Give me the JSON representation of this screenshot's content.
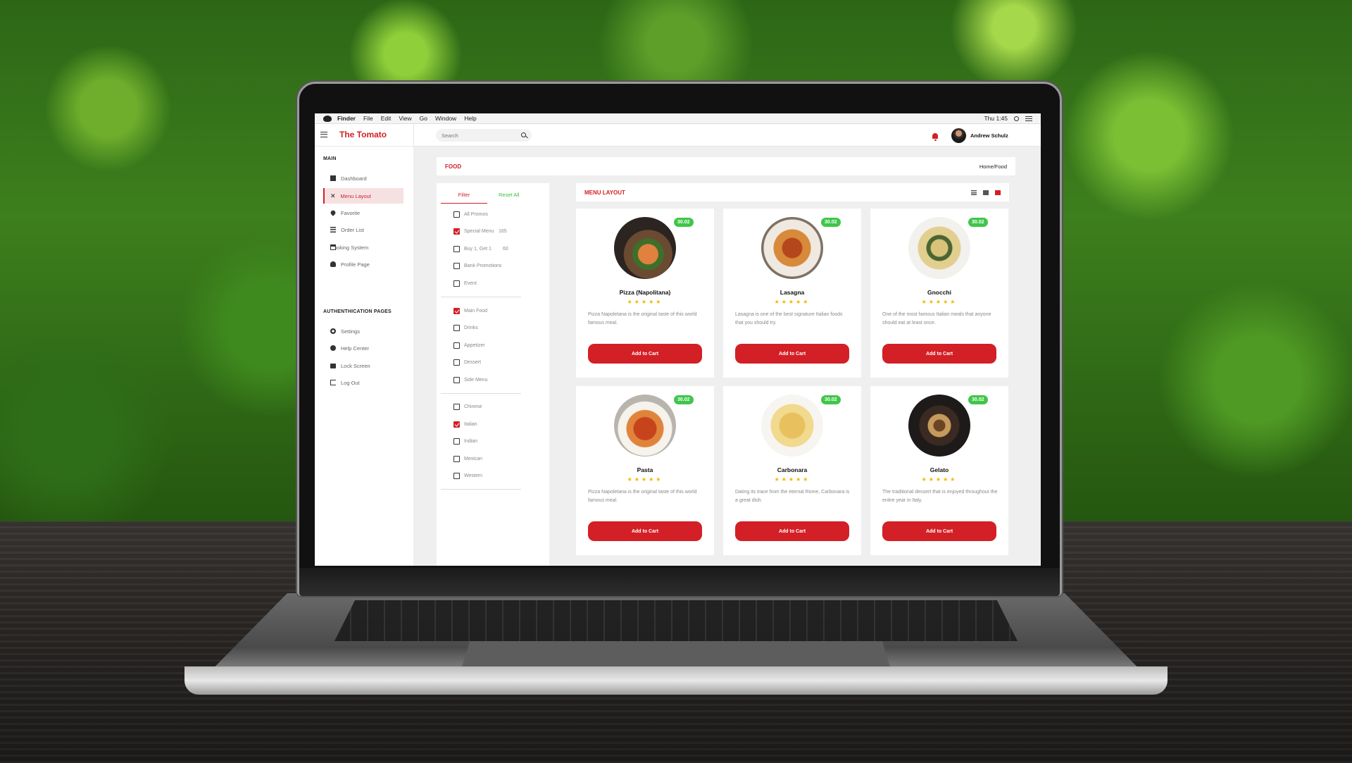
{
  "menubar": {
    "app": "Finder",
    "items": [
      "File",
      "Edit",
      "View",
      "Go",
      "Window",
      "Help"
    ],
    "clock": "Thu 1:45"
  },
  "topbar": {
    "brand": "The Tomato",
    "search_placeholder": "Search",
    "user_name": "Andrew Schulz"
  },
  "sidebar": {
    "main_heading": "MAIN",
    "items": [
      {
        "label": "Dashboard",
        "icon": "dashboard-icon"
      },
      {
        "label": "Menu Layout",
        "icon": "utensils-icon",
        "active": true
      },
      {
        "label": "Favorite",
        "icon": "heart-icon"
      },
      {
        "label": "Order List",
        "icon": "list-icon"
      },
      {
        "label": "Booking System",
        "icon": "credit-card-icon"
      },
      {
        "label": "Profile Page",
        "icon": "person-icon"
      }
    ],
    "auth_heading": "AUTHENTHICATION PAGES",
    "auth_items": [
      {
        "label": "Settings",
        "icon": "gear-icon"
      },
      {
        "label": "Help Center",
        "icon": "help-icon"
      },
      {
        "label": "Lock Screen",
        "icon": "lock-icon"
      },
      {
        "label": "Log Out",
        "icon": "logout-icon"
      }
    ]
  },
  "page": {
    "title": "FOOD",
    "breadcrumb": "Home/Food"
  },
  "filter": {
    "tab_filter": "Filter",
    "tab_reset": "Reset All",
    "groups": [
      [
        {
          "label": "All Promos",
          "checked": false,
          "count": ""
        },
        {
          "label": "Special Menu",
          "checked": true,
          "count": "165"
        },
        {
          "label": "Buy 1, Get 1",
          "checked": false,
          "count": "60"
        },
        {
          "label": "Bank Promotions",
          "checked": false,
          "count": ""
        },
        {
          "label": "Event",
          "checked": false,
          "count": ""
        }
      ],
      [
        {
          "label": "Main Food",
          "checked": true,
          "count": ""
        },
        {
          "label": "Drinks",
          "checked": false,
          "count": ""
        },
        {
          "label": "Appetizer",
          "checked": false,
          "count": ""
        },
        {
          "label": "Dessert",
          "checked": false,
          "count": ""
        },
        {
          "label": "Side Menu",
          "checked": false,
          "count": ""
        }
      ],
      [
        {
          "label": "Chinese",
          "checked": false,
          "count": ""
        },
        {
          "label": "Italian",
          "checked": true,
          "count": ""
        },
        {
          "label": "Indian",
          "checked": false,
          "count": ""
        },
        {
          "label": "Mexican",
          "checked": false,
          "count": ""
        },
        {
          "label": "Western",
          "checked": false,
          "count": ""
        }
      ]
    ]
  },
  "menu": {
    "title": "MENU LAYOUT",
    "view_icons": [
      "list-view-icon",
      "compact-list-view-icon",
      "grid-view-icon"
    ],
    "active_view": "grid-view-icon",
    "cards": [
      {
        "name": "Pizza (Napolitana)",
        "price": "30.02",
        "stars": "★★★★★",
        "desc": "Pizza Napoletana is the original taste of this world famous meal.",
        "button": "Add to Cart"
      },
      {
        "name": "Lasagna",
        "price": "30.02",
        "stars": "★★★★★",
        "desc": "Lasagna is one of the best signature Italian foods that you should try.",
        "button": "Add to Cart"
      },
      {
        "name": "Gnocchi",
        "price": "30.02",
        "stars": "★★★★★",
        "desc": "One of the most famous Italian meals that anyone should eat at least once.",
        "button": "Add to Cart"
      },
      {
        "name": "Pasta",
        "price": "30.02",
        "stars": "★★★★★",
        "desc": "Pizza Napoletana is the original taste of this world famous meal.",
        "button": "Add to Cart"
      },
      {
        "name": "Carbonara",
        "price": "30.02",
        "stars": "★★★★★",
        "desc": "Dating its trace from the eternal Rome, Carbonara is a great dish.",
        "button": "Add to Cart"
      },
      {
        "name": "Gelato",
        "price": "30.02",
        "stars": "★★★★★",
        "desc": "The traditional dessert that is enjoyed throughout the entire year in Italy.",
        "button": "Add to Cart"
      }
    ]
  },
  "colors": {
    "accent": "#d31f26",
    "price_badge": "#3fc64a",
    "stars": "#f2b600"
  }
}
